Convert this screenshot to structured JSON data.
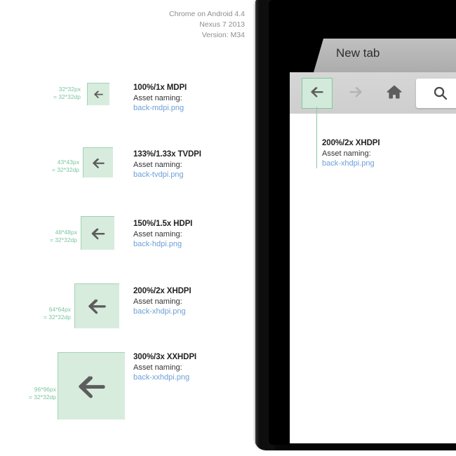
{
  "document": {
    "header_lines": [
      "Chrome on Android 4.4",
      "Nexus 7 2013",
      "Version: M34"
    ]
  },
  "colors": {
    "asset_fill": "#d7ecdd",
    "asset_border": "#9fd3b5",
    "arrow": "#5d5d5d",
    "px_label": "#7cc6a0",
    "filename_link": "#6c9fd6",
    "title": "#222222",
    "header_text": "#8e8e8e",
    "toolbar_bg": "#d2d2d2",
    "tab_bg": "#b4b4b4",
    "callout_line": "#8cc9a7"
  },
  "spec_rows": [
    {
      "px": "32*32px",
      "dp": "= 32*32dp",
      "title": "100%/1x MDPI",
      "subtitle": "Asset naming:",
      "filename": "back-mdpi.png",
      "icon_name": "back-arrow-icon"
    },
    {
      "px": "43*43px",
      "dp": "= 32*32dp",
      "title": "133%/1.33x TVDPI",
      "subtitle": "Asset naming:",
      "filename": "back-tvdpi.png",
      "icon_name": "back-arrow-icon"
    },
    {
      "px": "48*48px",
      "dp": "= 32*32dp",
      "title": "150%/1.5x HDPI",
      "subtitle": "Asset naming:",
      "filename": "back-hdpi.png",
      "icon_name": "back-arrow-icon"
    },
    {
      "px": "64*64px",
      "dp": "= 32*32dp",
      "title": "200%/2x XHDPI",
      "subtitle": "Asset naming:",
      "filename": "back-xhdpi.png",
      "icon_name": "back-arrow-icon"
    },
    {
      "px": "96*96px",
      "dp": "= 32*32dp",
      "title": "300%/3x XXHDPI",
      "subtitle": "Asset naming:",
      "filename": "back-xxhdpi.png",
      "icon_name": "back-arrow-icon"
    }
  ],
  "device": {
    "browser": {
      "tab_label": "New tab",
      "toolbar_buttons": [
        {
          "name": "back-button",
          "icon": "back-arrow-icon",
          "state": "highlighted"
        },
        {
          "name": "forward-button",
          "icon": "forward-arrow-icon",
          "state": "disabled"
        },
        {
          "name": "home-button",
          "icon": "home-icon",
          "state": "enabled"
        }
      ],
      "omnibox": {
        "icon": "search-icon",
        "value": "",
        "placeholder": ""
      }
    },
    "callout": {
      "title": "200%/2x XHDPI",
      "subtitle": "Asset naming:",
      "filename": "back-xhdpi.png"
    }
  }
}
